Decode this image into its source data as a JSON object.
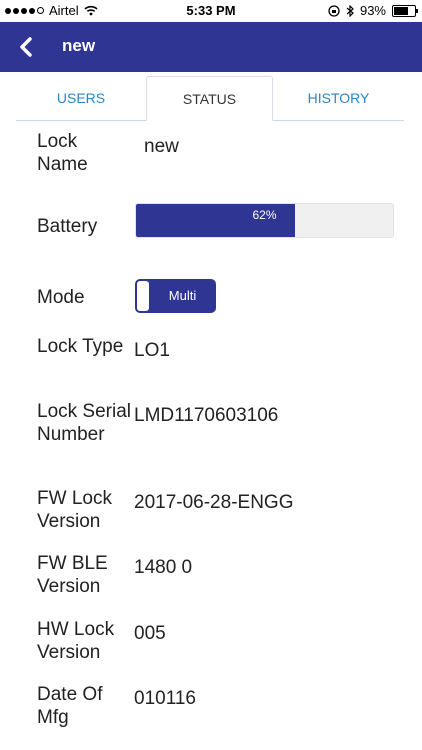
{
  "status_bar": {
    "carrier": "Airtel",
    "time": "5:33 PM",
    "battery_percent": "93%"
  },
  "header": {
    "title": "new"
  },
  "tabs": [
    {
      "label": "USERS",
      "active": false
    },
    {
      "label": "STATUS",
      "active": true
    },
    {
      "label": "HISTORY",
      "active": false
    }
  ],
  "status": {
    "lock_name_label": "Lock Name",
    "lock_name": "new",
    "battery_label": "Battery",
    "battery_level": 0.62,
    "battery_text": "62%",
    "mode_label": "Mode",
    "mode_value": "Multi",
    "lock_type_label": "Lock Type",
    "lock_type": "LO1",
    "serial_label": "Lock Serial Number",
    "serial": "LMD1170603106",
    "fw_lock_label": "FW Lock Version",
    "fw_lock": "2017-06-28-ENGG",
    "fw_ble_label": "FW BLE Version",
    "fw_ble": "1480 0",
    "hw_lock_label": "HW Lock Version",
    "hw_lock": "005",
    "mfg_label": "Date Of Mfg",
    "mfg": "010116"
  },
  "colors": {
    "brand": "#2f3593",
    "tab_link": "#2b86c7"
  }
}
